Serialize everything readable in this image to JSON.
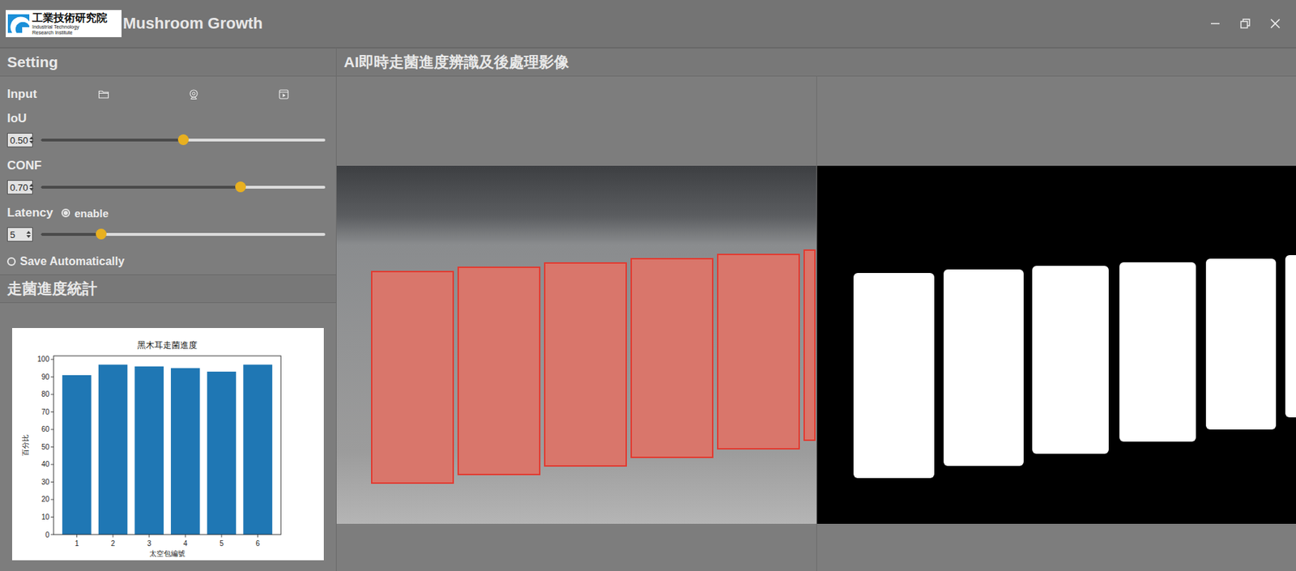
{
  "window": {
    "title": "Mushroom Growth",
    "logo": {
      "name": "工業技術研究院",
      "subtitle": [
        "Industrial Technology",
        "Research Institute"
      ]
    }
  },
  "settings": {
    "title": "Setting",
    "input": {
      "label": "Input"
    },
    "params": [
      {
        "label": "IoU",
        "value": "0.50",
        "level": 0.5
      },
      {
        "label": "CONF",
        "value": "0.70",
        "level": 0.7
      },
      {
        "label": "Latency",
        "value": "5",
        "level": 0.21,
        "toggle": {
          "label": "enable",
          "selected": true
        }
      }
    ],
    "save_automatically": {
      "label": "Save Automatically",
      "selected": false
    }
  },
  "stats": {
    "title": "走菌進度統計",
    "chart": {
      "title": "黑木耳走菌進度",
      "y_label": "百分比",
      "x_label": "太空包編號",
      "y_ticks": [
        "0",
        "10",
        "20",
        "30",
        "40",
        "50",
        "60",
        "70",
        "80",
        "90",
        "100"
      ],
      "x_ticks": [
        "1",
        "2",
        "3",
        "4",
        "5",
        "6"
      ],
      "series": [
        {
          "values": [
            91,
            97,
            96,
            95,
            93,
            97
          ]
        }
      ]
    }
  },
  "view": {
    "title": "AI即時走菌進度辨識及後處理影像"
  }
}
